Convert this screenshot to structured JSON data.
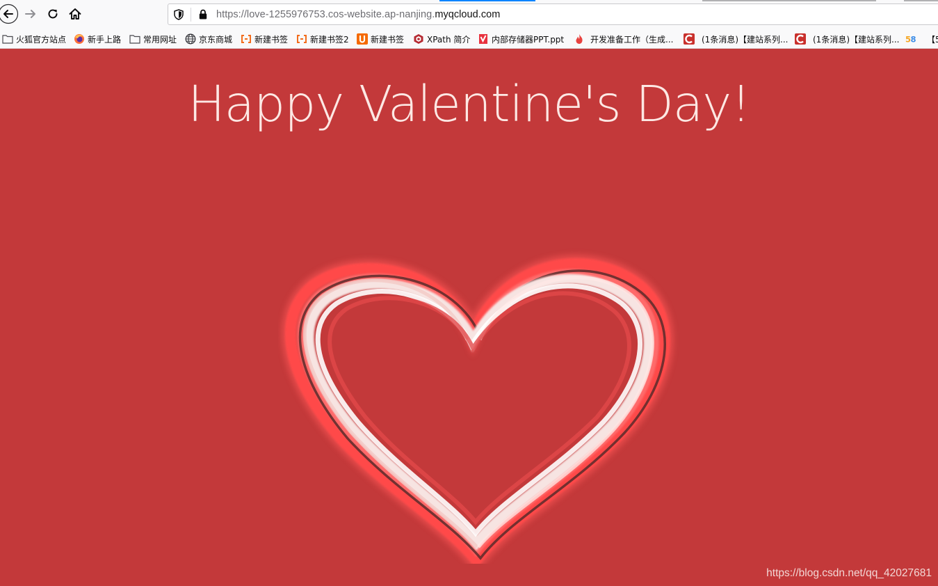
{
  "browser": {
    "url_prefix": "https://love-1255976753.cos-website.ap-nanjing.",
    "url_domain": "myqcloud.com",
    "nav_icons": [
      "back-arrow-icon",
      "forward-arrow-icon",
      "reload-icon",
      "home-icon"
    ]
  },
  "bookmarks": [
    {
      "label": "火狐官方站点",
      "icon": "folder-icon"
    },
    {
      "label": "新手上路",
      "icon": "firefox-icon"
    },
    {
      "label": "常用网址",
      "icon": "folder-icon"
    },
    {
      "label": "京东商城",
      "icon": "globe-icon"
    },
    {
      "label": "新建书签",
      "icon": "bracket-icon"
    },
    {
      "label": "新建书签2",
      "icon": "bracket-icon"
    },
    {
      "label": "新建书签",
      "icon": "u-logo-icon"
    },
    {
      "label": "XPath 简介",
      "icon": "xpath-icon"
    },
    {
      "label": "内部存储器PPT.ppt",
      "icon": "doc-icon"
    },
    {
      "label": "开发准备工作（生成...",
      "icon": "flame-icon"
    },
    {
      "label": "(1条消息)【建站系列...",
      "icon": "csdn-icon"
    },
    {
      "label": "(1条消息)【建站系列...",
      "icon": "csdn-icon"
    },
    {
      "label": "",
      "icon": "58-logo-icon"
    },
    {
      "label": "【5",
      "icon": ""
    }
  ],
  "page": {
    "headline": "Happy Valentine's Day!",
    "watermark": "https://blog.csdn.net/qq_42027681",
    "colors": {
      "background": "#c3393a",
      "headline": "#fde8e4",
      "heart_white": "#f7e4e2",
      "heart_red": "#ff4b4b",
      "heart_dark": "#5a2a2a"
    }
  }
}
